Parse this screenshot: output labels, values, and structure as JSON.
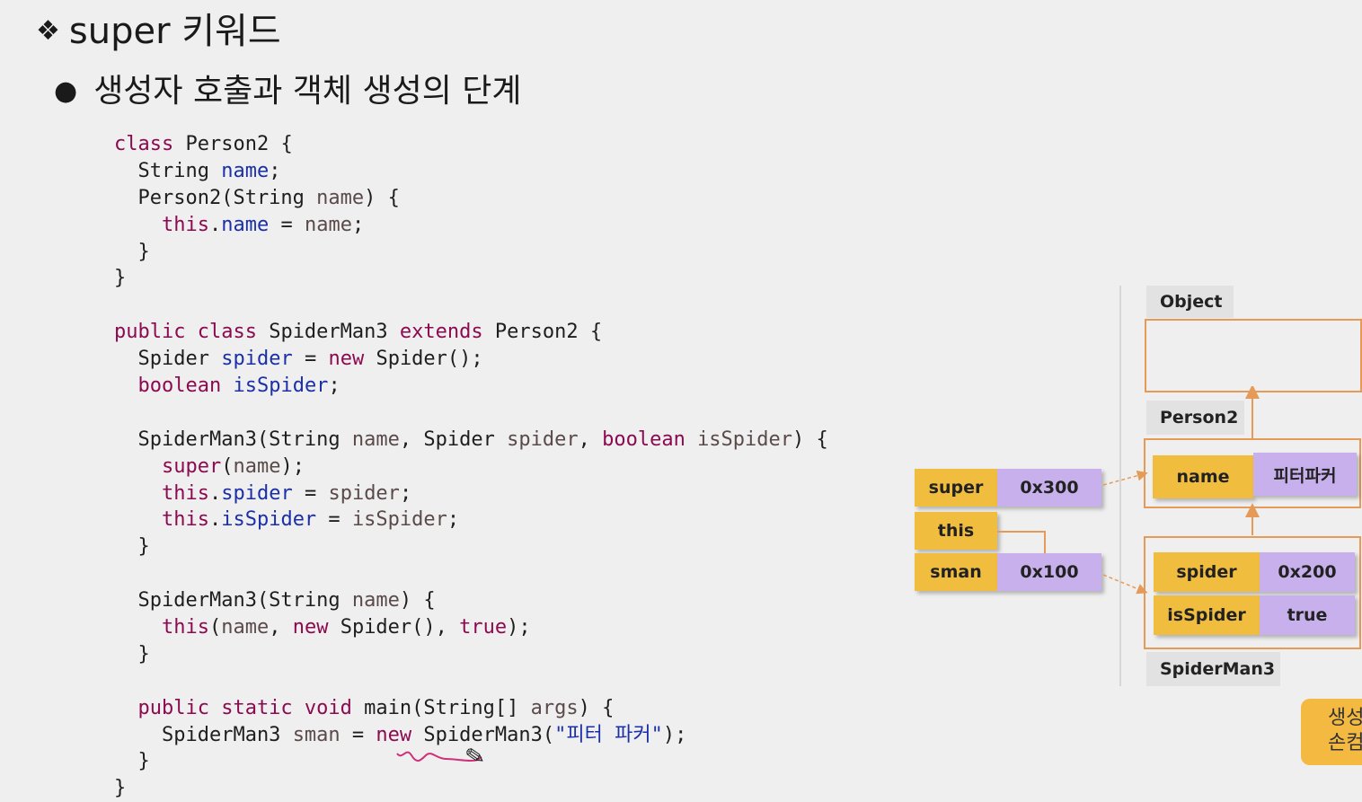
{
  "slide": {
    "title_bullet": "❖",
    "title": "super 키워드",
    "subtitle_bullet": "●",
    "subtitle": "생성자 호출과 객체 생성의 단계"
  },
  "code_lines": [
    [
      [
        "kw",
        "class"
      ],
      [
        "pl",
        " Person2 {"
      ]
    ],
    [
      [
        "pl",
        "  String "
      ],
      [
        "fld",
        "name"
      ],
      [
        "pl",
        ";"
      ]
    ],
    [
      [
        "pl",
        "  Person2(String "
      ],
      [
        "prm",
        "name"
      ],
      [
        "pl",
        ") {"
      ]
    ],
    [
      [
        "kw",
        "    this"
      ],
      [
        "pl",
        "."
      ],
      [
        "fld",
        "name"
      ],
      [
        "pl",
        " = "
      ],
      [
        "prm",
        "name"
      ],
      [
        "pl",
        ";"
      ]
    ],
    [
      [
        "pl",
        "  }"
      ]
    ],
    [
      [
        "pl",
        "}"
      ]
    ],
    [
      [
        "pl",
        ""
      ]
    ],
    [
      [
        "kw",
        "public class"
      ],
      [
        "pl",
        " SpiderMan3 "
      ],
      [
        "kw",
        "extends"
      ],
      [
        "pl",
        " Person2 {"
      ]
    ],
    [
      [
        "pl",
        "  Spider "
      ],
      [
        "fld",
        "spider"
      ],
      [
        "pl",
        " = "
      ],
      [
        "kw",
        "new"
      ],
      [
        "pl",
        " Spider();"
      ]
    ],
    [
      [
        "kw",
        "  boolean"
      ],
      [
        "pl",
        " "
      ],
      [
        "fld",
        "isSpider"
      ],
      [
        "pl",
        ";"
      ]
    ],
    [
      [
        "pl",
        ""
      ]
    ],
    [
      [
        "pl",
        "  SpiderMan3(String "
      ],
      [
        "prm",
        "name"
      ],
      [
        "pl",
        ", Spider "
      ],
      [
        "prm",
        "spider"
      ],
      [
        "pl",
        ", "
      ],
      [
        "kw",
        "boolean"
      ],
      [
        "pl",
        " "
      ],
      [
        "prm",
        "isSpider"
      ],
      [
        "pl",
        ") {"
      ]
    ],
    [
      [
        "kw",
        "    super"
      ],
      [
        "pl",
        "("
      ],
      [
        "prm",
        "name"
      ],
      [
        "pl",
        ");"
      ]
    ],
    [
      [
        "kw",
        "    this"
      ],
      [
        "pl",
        "."
      ],
      [
        "fld",
        "spider"
      ],
      [
        "pl",
        " = "
      ],
      [
        "prm",
        "spider"
      ],
      [
        "pl",
        ";"
      ]
    ],
    [
      [
        "kw",
        "    this"
      ],
      [
        "pl",
        "."
      ],
      [
        "fld",
        "isSpider"
      ],
      [
        "pl",
        " = "
      ],
      [
        "prm",
        "isSpider"
      ],
      [
        "pl",
        ";"
      ]
    ],
    [
      [
        "pl",
        "  }"
      ]
    ],
    [
      [
        "pl",
        ""
      ]
    ],
    [
      [
        "pl",
        "  SpiderMan3(String "
      ],
      [
        "prm",
        "name"
      ],
      [
        "pl",
        ") {"
      ]
    ],
    [
      [
        "kw",
        "    this"
      ],
      [
        "pl",
        "("
      ],
      [
        "prm",
        "name"
      ],
      [
        "pl",
        ", "
      ],
      [
        "kw",
        "new"
      ],
      [
        "pl",
        " Spider(), "
      ],
      [
        "kw",
        "true"
      ],
      [
        "pl",
        ");"
      ]
    ],
    [
      [
        "pl",
        "  }"
      ]
    ],
    [
      [
        "pl",
        ""
      ]
    ],
    [
      [
        "kw",
        "  public static void"
      ],
      [
        "pl",
        " main(String[] "
      ],
      [
        "prm",
        "args"
      ],
      [
        "pl",
        ") {"
      ]
    ],
    [
      [
        "pl",
        "    SpiderMan3 "
      ],
      [
        "prm",
        "sman"
      ],
      [
        "pl",
        " = "
      ],
      [
        "kw",
        "new"
      ],
      [
        "pl",
        " SpiderMan3("
      ],
      [
        "str",
        "\"피터 파커\""
      ],
      [
        "pl",
        ");"
      ]
    ],
    [
      [
        "pl",
        "  }"
      ]
    ],
    [
      [
        "pl",
        "}"
      ]
    ]
  ],
  "memory_diagram": {
    "stack": {
      "super_label": "super",
      "super_value": "0x300",
      "this_label": "this",
      "sman_label": "sman",
      "sman_value": "0x100"
    },
    "heap": {
      "object_label": "Object",
      "person2_label": "Person2",
      "name_field": "name",
      "name_value": "피터파커",
      "spider_field": "spider",
      "spider_value": "0x200",
      "isspider_field": "isSpider",
      "isspider_value": "true",
      "spiderman3_label": "SpiderMan3"
    },
    "note_text_line1": "생성",
    "note_text_line2": "손컴"
  },
  "colors": {
    "gold": "#f1bd3e",
    "lavender": "#c7b0ec",
    "frame": "#e59a58",
    "keyword": "#8b0a50",
    "field": "#1a2fa8"
  }
}
